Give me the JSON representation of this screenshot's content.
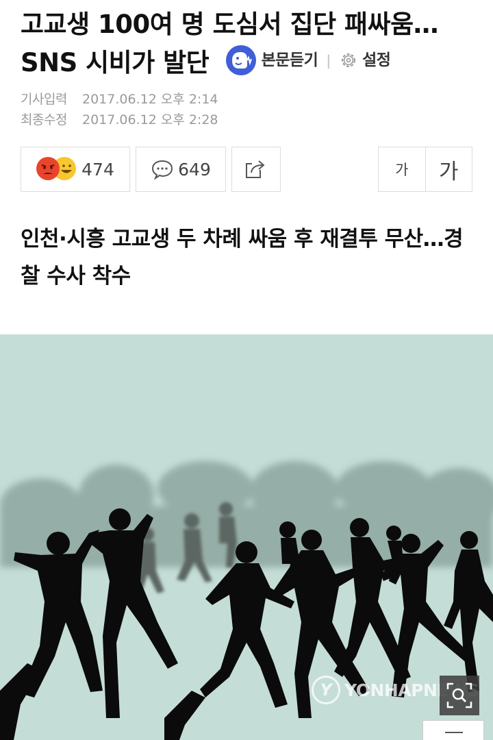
{
  "article": {
    "title": "고교생 100여 명 도심서 집단 패싸움…SNS 시비가 발단",
    "subtitle": "인천·시흥 고교생 두 차례 싸움 후 재결투 무산…경찰 수사 착수"
  },
  "tools": {
    "listen_label": "본문듣기",
    "separator": "|",
    "settings_label": "설정"
  },
  "meta": {
    "published_label": "기사입력",
    "published_value": "2017.06.12 오후 2:14",
    "modified_label": "최종수정",
    "modified_value": "2017.06.12 오후 2:28"
  },
  "actions": {
    "reaction_count": "474",
    "comment_count": "649",
    "font_small_label": "가",
    "font_large_label": "가"
  },
  "photo": {
    "watermark_text": "YONHAPNEWS",
    "watermark_logo": "Y"
  },
  "icons": {
    "listen": "speaker-face-icon",
    "settings": "gear-icon",
    "reaction_angry": "angry-emoji-icon",
    "reaction_smile": "smile-emoji-icon",
    "comment": "speech-bubble-icon",
    "share": "share-icon",
    "zoom": "zoom-icon"
  },
  "colors": {
    "listen_icon_bg": "#3f5ed8",
    "angry": "#e8452c",
    "smile": "#f7c631",
    "photo_bg": "#c5ddd7",
    "meta_text": "#9a9a9a"
  }
}
